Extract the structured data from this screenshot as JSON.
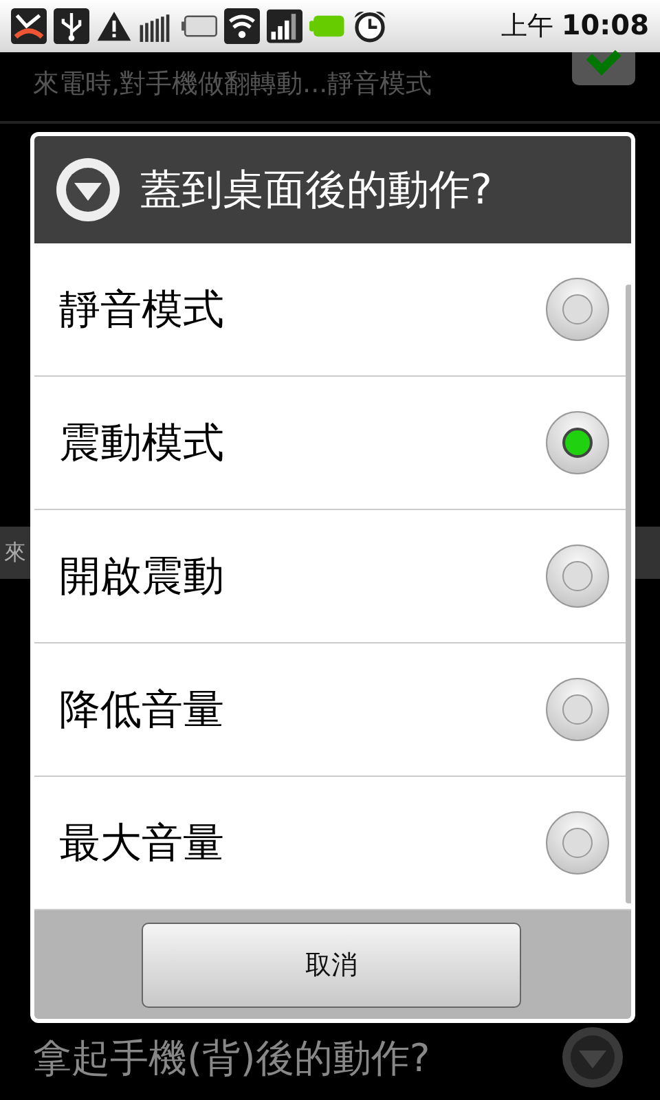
{
  "status_bar": {
    "am_pm": "上午",
    "time": "10:08"
  },
  "background_list": {
    "rows": [
      {
        "kind": "setting",
        "subtitle": "來電時,對手機做翻轉動...靜音模式",
        "checked": true
      },
      {
        "kind": "header",
        "title": "來"
      },
      {
        "kind": "dropdown",
        "title": "拿起手機(背)後的動作?"
      }
    ]
  },
  "dialog": {
    "title": "蓋到桌面後的動作?",
    "options": [
      {
        "label": "靜音模式",
        "selected": false
      },
      {
        "label": "震動模式",
        "selected": true
      },
      {
        "label": "開啟震動",
        "selected": false
      },
      {
        "label": "降低音量",
        "selected": false
      },
      {
        "label": "最大音量",
        "selected": false
      }
    ],
    "buttons": [
      "取消"
    ]
  }
}
